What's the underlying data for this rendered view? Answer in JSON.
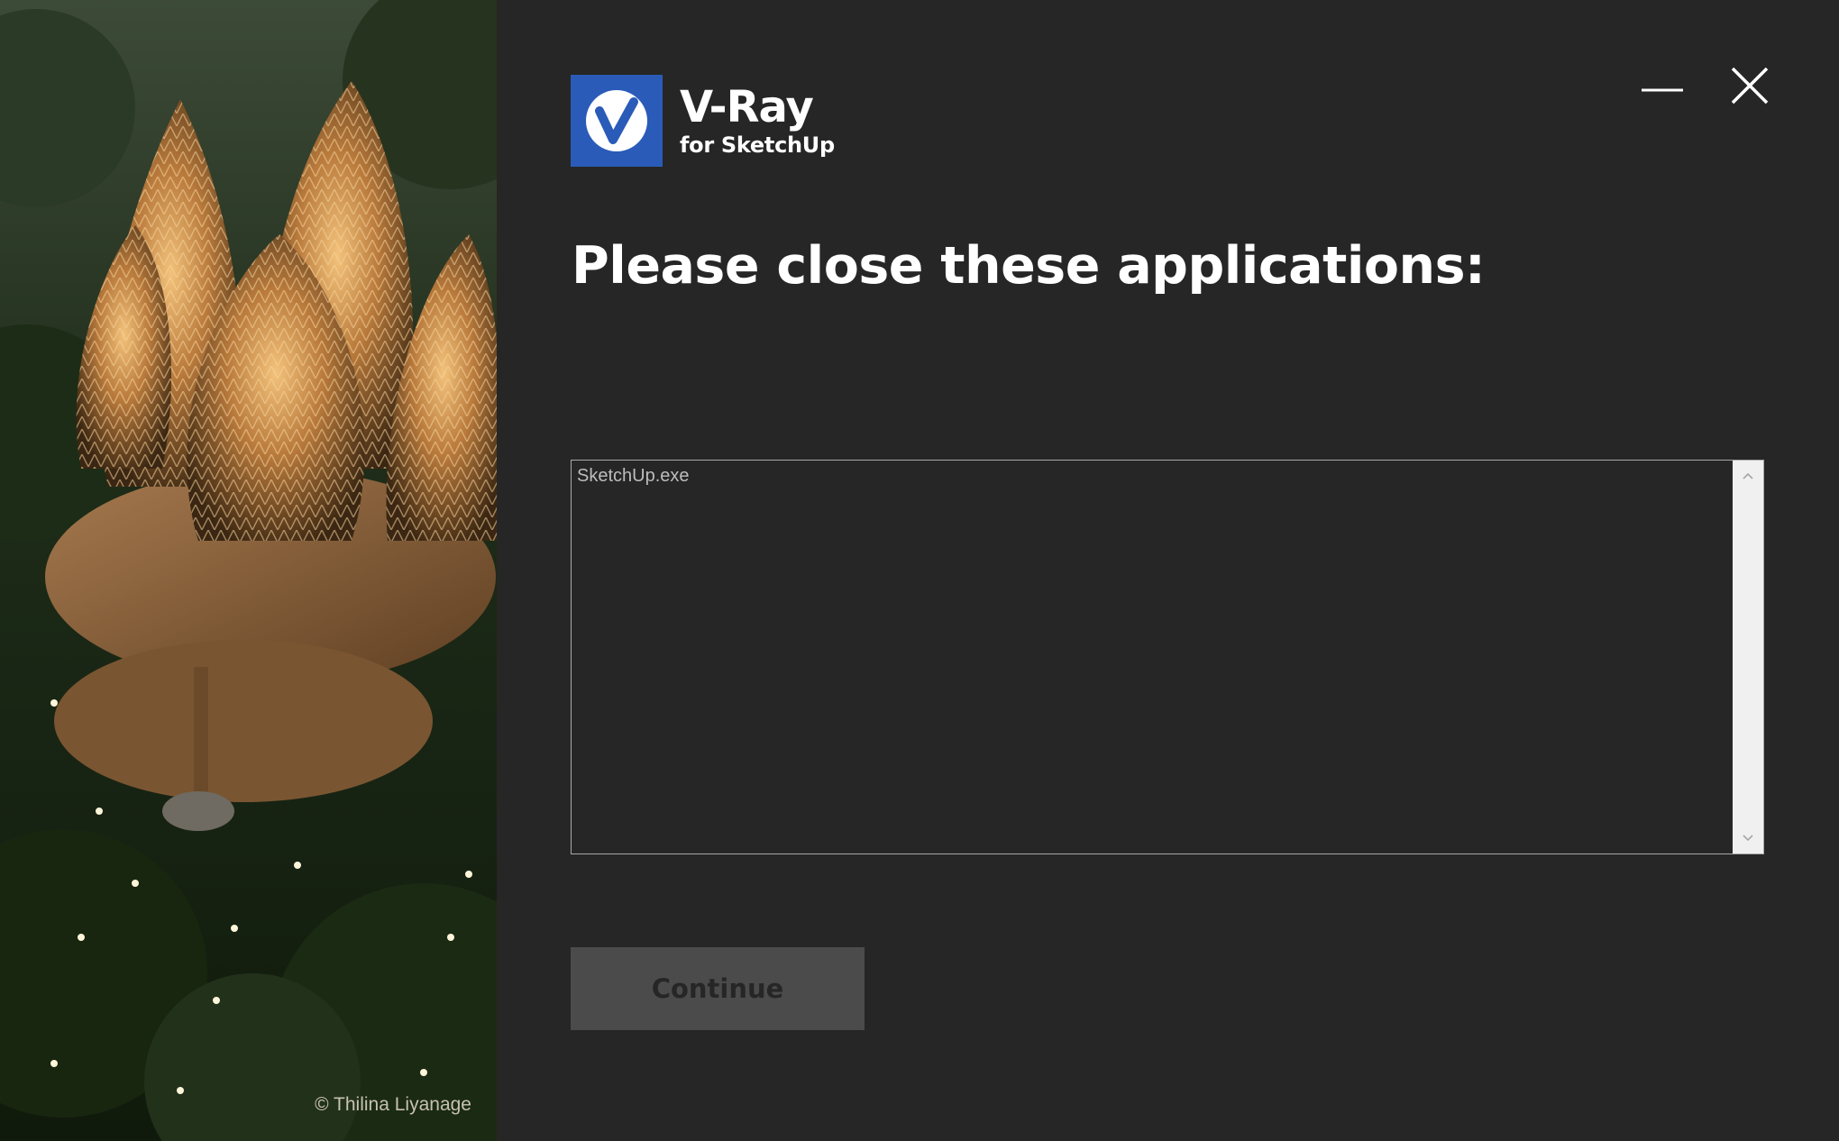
{
  "app": {
    "logo_title": "V-Ray",
    "logo_subtitle": "for SketchUp",
    "brand_color": "#2a5bb8"
  },
  "window_controls": {
    "minimize_icon": "minimize-icon",
    "close_icon": "close-icon"
  },
  "main": {
    "heading": "Please close these applications:",
    "applications": [
      "SketchUp.exe"
    ],
    "continue_label": "Continue",
    "continue_enabled": false
  },
  "artwork": {
    "credit": "© Thilina Liyanage"
  }
}
